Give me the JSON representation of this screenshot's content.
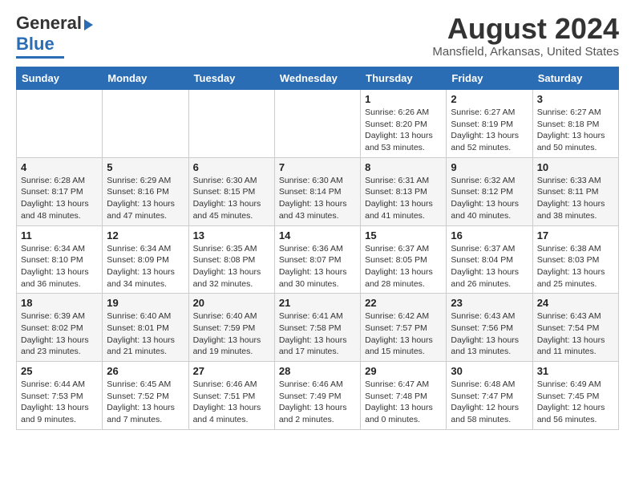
{
  "header": {
    "logo_line1": "General",
    "logo_line2": "Blue",
    "month_title": "August 2024",
    "location": "Mansfield, Arkansas, United States"
  },
  "days_of_week": [
    "Sunday",
    "Monday",
    "Tuesday",
    "Wednesday",
    "Thursday",
    "Friday",
    "Saturday"
  ],
  "weeks": [
    [
      {
        "day": "",
        "info": ""
      },
      {
        "day": "",
        "info": ""
      },
      {
        "day": "",
        "info": ""
      },
      {
        "day": "",
        "info": ""
      },
      {
        "day": "1",
        "info": "Sunrise: 6:26 AM\nSunset: 8:20 PM\nDaylight: 13 hours\nand 53 minutes."
      },
      {
        "day": "2",
        "info": "Sunrise: 6:27 AM\nSunset: 8:19 PM\nDaylight: 13 hours\nand 52 minutes."
      },
      {
        "day": "3",
        "info": "Sunrise: 6:27 AM\nSunset: 8:18 PM\nDaylight: 13 hours\nand 50 minutes."
      }
    ],
    [
      {
        "day": "4",
        "info": "Sunrise: 6:28 AM\nSunset: 8:17 PM\nDaylight: 13 hours\nand 48 minutes."
      },
      {
        "day": "5",
        "info": "Sunrise: 6:29 AM\nSunset: 8:16 PM\nDaylight: 13 hours\nand 47 minutes."
      },
      {
        "day": "6",
        "info": "Sunrise: 6:30 AM\nSunset: 8:15 PM\nDaylight: 13 hours\nand 45 minutes."
      },
      {
        "day": "7",
        "info": "Sunrise: 6:30 AM\nSunset: 8:14 PM\nDaylight: 13 hours\nand 43 minutes."
      },
      {
        "day": "8",
        "info": "Sunrise: 6:31 AM\nSunset: 8:13 PM\nDaylight: 13 hours\nand 41 minutes."
      },
      {
        "day": "9",
        "info": "Sunrise: 6:32 AM\nSunset: 8:12 PM\nDaylight: 13 hours\nand 40 minutes."
      },
      {
        "day": "10",
        "info": "Sunrise: 6:33 AM\nSunset: 8:11 PM\nDaylight: 13 hours\nand 38 minutes."
      }
    ],
    [
      {
        "day": "11",
        "info": "Sunrise: 6:34 AM\nSunset: 8:10 PM\nDaylight: 13 hours\nand 36 minutes."
      },
      {
        "day": "12",
        "info": "Sunrise: 6:34 AM\nSunset: 8:09 PM\nDaylight: 13 hours\nand 34 minutes."
      },
      {
        "day": "13",
        "info": "Sunrise: 6:35 AM\nSunset: 8:08 PM\nDaylight: 13 hours\nand 32 minutes."
      },
      {
        "day": "14",
        "info": "Sunrise: 6:36 AM\nSunset: 8:07 PM\nDaylight: 13 hours\nand 30 minutes."
      },
      {
        "day": "15",
        "info": "Sunrise: 6:37 AM\nSunset: 8:05 PM\nDaylight: 13 hours\nand 28 minutes."
      },
      {
        "day": "16",
        "info": "Sunrise: 6:37 AM\nSunset: 8:04 PM\nDaylight: 13 hours\nand 26 minutes."
      },
      {
        "day": "17",
        "info": "Sunrise: 6:38 AM\nSunset: 8:03 PM\nDaylight: 13 hours\nand 25 minutes."
      }
    ],
    [
      {
        "day": "18",
        "info": "Sunrise: 6:39 AM\nSunset: 8:02 PM\nDaylight: 13 hours\nand 23 minutes."
      },
      {
        "day": "19",
        "info": "Sunrise: 6:40 AM\nSunset: 8:01 PM\nDaylight: 13 hours\nand 21 minutes."
      },
      {
        "day": "20",
        "info": "Sunrise: 6:40 AM\nSunset: 7:59 PM\nDaylight: 13 hours\nand 19 minutes."
      },
      {
        "day": "21",
        "info": "Sunrise: 6:41 AM\nSunset: 7:58 PM\nDaylight: 13 hours\nand 17 minutes."
      },
      {
        "day": "22",
        "info": "Sunrise: 6:42 AM\nSunset: 7:57 PM\nDaylight: 13 hours\nand 15 minutes."
      },
      {
        "day": "23",
        "info": "Sunrise: 6:43 AM\nSunset: 7:56 PM\nDaylight: 13 hours\nand 13 minutes."
      },
      {
        "day": "24",
        "info": "Sunrise: 6:43 AM\nSunset: 7:54 PM\nDaylight: 13 hours\nand 11 minutes."
      }
    ],
    [
      {
        "day": "25",
        "info": "Sunrise: 6:44 AM\nSunset: 7:53 PM\nDaylight: 13 hours\nand 9 minutes."
      },
      {
        "day": "26",
        "info": "Sunrise: 6:45 AM\nSunset: 7:52 PM\nDaylight: 13 hours\nand 7 minutes."
      },
      {
        "day": "27",
        "info": "Sunrise: 6:46 AM\nSunset: 7:51 PM\nDaylight: 13 hours\nand 4 minutes."
      },
      {
        "day": "28",
        "info": "Sunrise: 6:46 AM\nSunset: 7:49 PM\nDaylight: 13 hours\nand 2 minutes."
      },
      {
        "day": "29",
        "info": "Sunrise: 6:47 AM\nSunset: 7:48 PM\nDaylight: 13 hours\nand 0 minutes."
      },
      {
        "day": "30",
        "info": "Sunrise: 6:48 AM\nSunset: 7:47 PM\nDaylight: 12 hours\nand 58 minutes."
      },
      {
        "day": "31",
        "info": "Sunrise: 6:49 AM\nSunset: 7:45 PM\nDaylight: 12 hours\nand 56 minutes."
      }
    ]
  ]
}
